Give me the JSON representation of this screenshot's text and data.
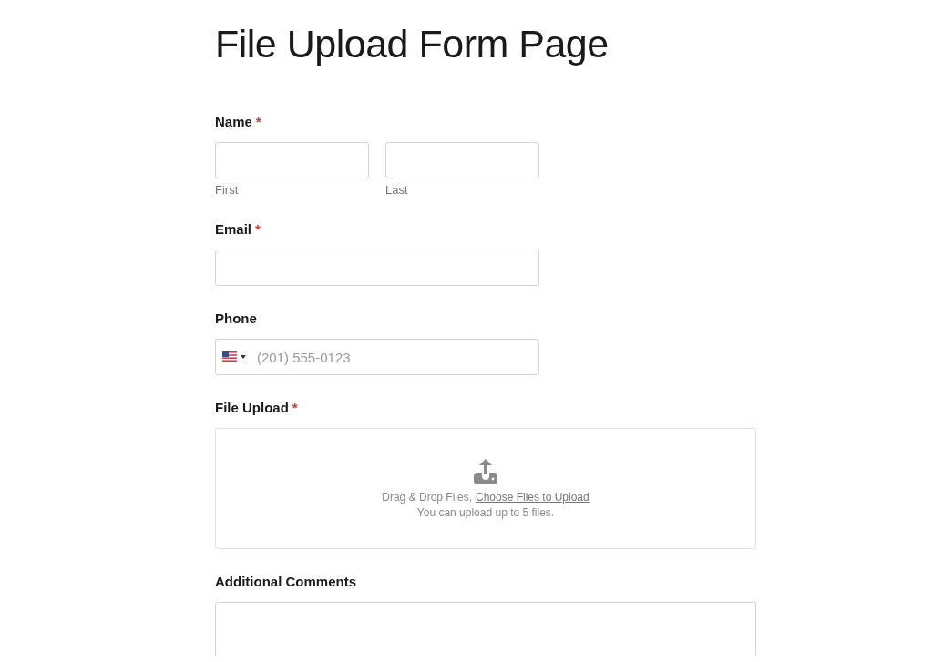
{
  "title": "File Upload Form Page",
  "fields": [
    {
      "kind": "name",
      "label": "Name",
      "required_mark": "*",
      "parts": [
        {
          "sublabel": "First"
        },
        {
          "sublabel": "Last"
        }
      ]
    },
    {
      "kind": "text",
      "label": "Email",
      "required_mark": "*"
    },
    {
      "kind": "phone",
      "label": "Phone",
      "placeholder": "(201) 555-0123"
    },
    {
      "kind": "upload",
      "label": "File Upload",
      "required_mark": "*",
      "prompt": "Drag & Drop Files,",
      "link": "Choose Files to Upload",
      "hint": "You can upload up to 5 files."
    },
    {
      "kind": "textarea",
      "label": "Additional Comments"
    }
  ]
}
